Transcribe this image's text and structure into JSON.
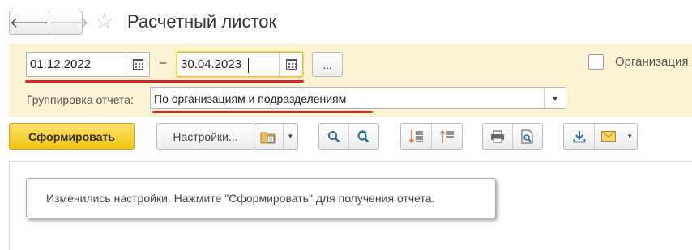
{
  "window": {
    "title": "Расчетный листок"
  },
  "period": {
    "start_date": "01.12.2022",
    "separator": "–",
    "end_date": "30.04.2023",
    "select_button_label": "..."
  },
  "organization": {
    "label": "Организация",
    "checked": false
  },
  "grouping": {
    "label": "Группировка отчета:",
    "value": "По организациям и подразделениям"
  },
  "toolbar": {
    "generate_label": "Сформировать",
    "settings_label": "Настройки..."
  },
  "report": {
    "message": "Изменились настройки. Нажмите \"Сформировать\" для получения отчета."
  },
  "colors": {
    "panel_bg": "#fbf3d4",
    "primary_button": "#f2c40e",
    "annotation_red": "#e0242a",
    "icon_blue": "#2e6da8"
  }
}
